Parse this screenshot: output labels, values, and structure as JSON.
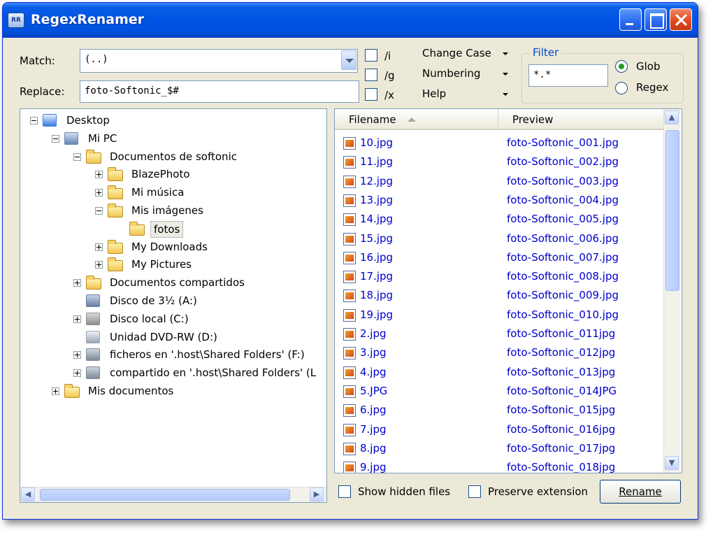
{
  "window": {
    "title": "RegexRenamer",
    "app_icon_text": "RR"
  },
  "match": {
    "label": "Match:",
    "value": "(..)"
  },
  "replace": {
    "label": "Replace:",
    "value": "foto-Softonic_$#"
  },
  "options": [
    {
      "label": "/i",
      "checked": false
    },
    {
      "label": "/g",
      "checked": false
    },
    {
      "label": "/x",
      "checked": false
    }
  ],
  "menus": [
    {
      "label": "Change Case"
    },
    {
      "label": "Numbering"
    },
    {
      "label": "Help"
    }
  ],
  "filter": {
    "title": "Filter",
    "value": "*.*",
    "glob_label": "Glob",
    "regex_label": "Regex",
    "selected": "Glob"
  },
  "tree": [
    {
      "label": "Desktop",
      "level": 0,
      "expander": "minus",
      "icon": "desktop"
    },
    {
      "label": "Mi PC",
      "level": 1,
      "expander": "minus",
      "icon": "computer"
    },
    {
      "label": "Documentos de softonic",
      "level": 2,
      "expander": "minus",
      "icon": "folder"
    },
    {
      "label": "BlazePhoto",
      "level": 3,
      "expander": "plus",
      "icon": "folder"
    },
    {
      "label": "Mi música",
      "level": 3,
      "expander": "plus",
      "icon": "music-folder"
    },
    {
      "label": "Mis imágenes",
      "level": 3,
      "expander": "minus",
      "icon": "pictures-folder"
    },
    {
      "label": "fotos",
      "level": 4,
      "expander": "none",
      "icon": "folder",
      "selected": true
    },
    {
      "label": "My Downloads",
      "level": 3,
      "expander": "plus",
      "icon": "folder"
    },
    {
      "label": "My Pictures",
      "level": 3,
      "expander": "plus",
      "icon": "folder"
    },
    {
      "label": "Documentos compartidos",
      "level": 2,
      "expander": "plus",
      "icon": "folder"
    },
    {
      "label": "Disco de 3½ (A:)",
      "level": 2,
      "expander": "none",
      "icon": "floppy"
    },
    {
      "label": "Disco local (C:)",
      "level": 2,
      "expander": "plus",
      "icon": "drive"
    },
    {
      "label": "Unidad DVD-RW (D:)",
      "level": 2,
      "expander": "none",
      "icon": "dvd"
    },
    {
      "label": "ficheros en '.host\\Shared Folders' (F:)",
      "level": 2,
      "expander": "plus",
      "icon": "network-drive"
    },
    {
      "label": "compartido en '.host\\Shared Folders' (L",
      "level": 2,
      "expander": "plus",
      "icon": "network-drive"
    },
    {
      "label": "Mis documentos",
      "level": 1,
      "expander": "plus",
      "icon": "folder"
    }
  ],
  "list": {
    "headers": {
      "filename": "Filename",
      "preview": "Preview"
    },
    "rows": [
      {
        "filename": "10.jpg",
        "preview": "foto-Softonic_001.jpg"
      },
      {
        "filename": "11.jpg",
        "preview": "foto-Softonic_002.jpg"
      },
      {
        "filename": "12.jpg",
        "preview": "foto-Softonic_003.jpg"
      },
      {
        "filename": "13.jpg",
        "preview": "foto-Softonic_004.jpg"
      },
      {
        "filename": "14.jpg",
        "preview": "foto-Softonic_005.jpg"
      },
      {
        "filename": "15.jpg",
        "preview": "foto-Softonic_006.jpg"
      },
      {
        "filename": "16.jpg",
        "preview": "foto-Softonic_007.jpg"
      },
      {
        "filename": "17.jpg",
        "preview": "foto-Softonic_008.jpg"
      },
      {
        "filename": "18.jpg",
        "preview": "foto-Softonic_009.jpg"
      },
      {
        "filename": "19.jpg",
        "preview": "foto-Softonic_010.jpg"
      },
      {
        "filename": "2.jpg",
        "preview": "foto-Softonic_011jpg"
      },
      {
        "filename": "3.jpg",
        "preview": "foto-Softonic_012jpg"
      },
      {
        "filename": "4.jpg",
        "preview": "foto-Softonic_013jpg"
      },
      {
        "filename": "5.JPG",
        "preview": "foto-Softonic_014JPG"
      },
      {
        "filename": "6.jpg",
        "preview": "foto-Softonic_015jpg"
      },
      {
        "filename": "7.jpg",
        "preview": "foto-Softonic_016jpg"
      },
      {
        "filename": "8.jpg",
        "preview": "foto-Softonic_017jpg"
      },
      {
        "filename": "9.jpg",
        "preview": "foto-Softonic_018jpg"
      }
    ]
  },
  "bottom": {
    "show_hidden_label": "Show hidden files",
    "preserve_ext_label": "Preserve extension",
    "rename_label": "Rename"
  },
  "colors": {
    "title_bar": "#0054e3",
    "link_text": "#0000cc",
    "window_bg": "#ece9d8"
  }
}
